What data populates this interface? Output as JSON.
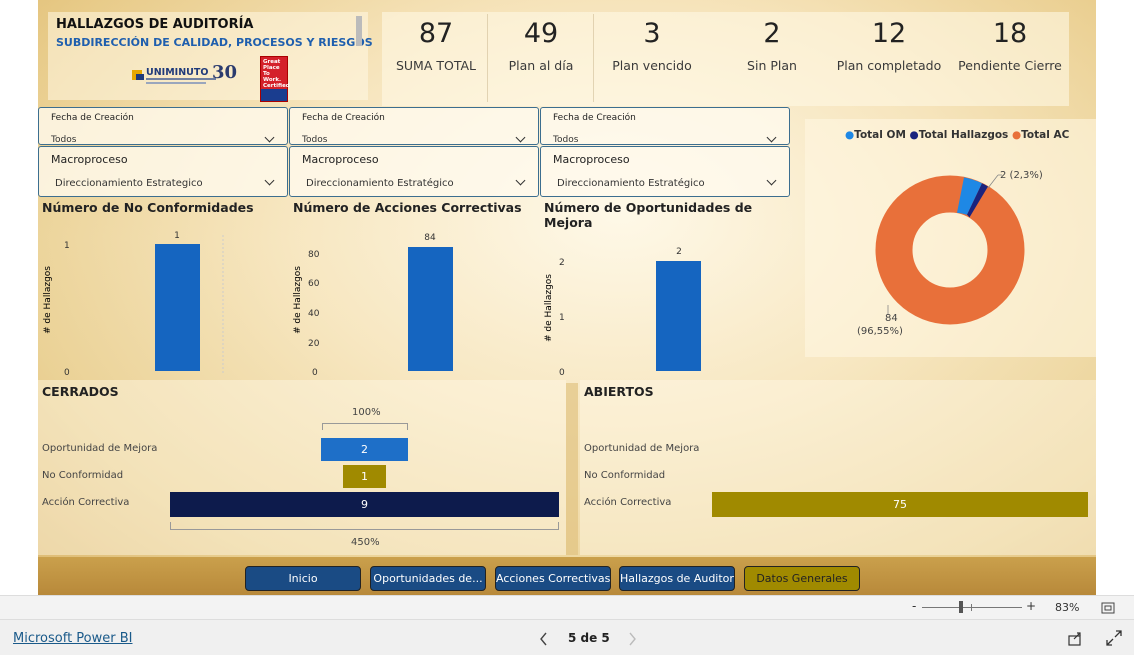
{
  "header": {
    "title": "HALLAZGOS DE AUDITORÍA",
    "subtitle": "SUBDIRECCIÓN DE CALIDAD, PROCESOS Y RIESGOS",
    "logo_text": "UNIMINUTO",
    "badge_lines": [
      "Great",
      "Place",
      "To",
      "Work.",
      "Certified"
    ]
  },
  "kpis": [
    {
      "value": "87",
      "label": "SUMA TOTAL"
    },
    {
      "value": "49",
      "label": "Plan al día"
    },
    {
      "value": "3",
      "label": "Plan vencido"
    },
    {
      "value": "2",
      "label": "Sin Plan"
    },
    {
      "value": "12",
      "label": "Plan completado"
    },
    {
      "value": "18",
      "label": "Pendiente Cierre"
    }
  ],
  "slicers": {
    "fecha_label": "Fecha de Creación",
    "fecha_value": "Todos",
    "macro_label": "Macroproceso",
    "macro_value": "Direccionamiento Estrategico",
    "macro_value_alt": "Direccionamiento Estratégico"
  },
  "charts": {
    "nc": {
      "title": "Número de No Conformidades",
      "ylabel": "# de Hallazgos"
    },
    "ac": {
      "title": "Número de Acciones Correctivas",
      "ylabel": "# de Hallazgos"
    },
    "om": {
      "title_line1": "Número de Oportunidades de",
      "title_line2": "Mejora",
      "ylabel": "# de Hallazgos"
    }
  },
  "chart_data": [
    {
      "type": "bar",
      "title": "Número de No Conformidades",
      "ylabel": "# de Hallazgos",
      "categories": [
        ""
      ],
      "values": [
        1
      ],
      "ylim": [
        0,
        1
      ],
      "yticks": [
        "0",
        "1"
      ],
      "data_labels": [
        "1"
      ]
    },
    {
      "type": "bar",
      "title": "Número de Acciones Correctivas",
      "ylabel": "# de Hallazgos",
      "categories": [
        ""
      ],
      "values": [
        84
      ],
      "ylim": [
        0,
        80
      ],
      "yticks": [
        "0",
        "20",
        "40",
        "60",
        "80"
      ],
      "data_labels": [
        "84"
      ]
    },
    {
      "type": "bar",
      "title": "Número de Oportunidades de Mejora",
      "ylabel": "# de Hallazgos",
      "categories": [
        ""
      ],
      "values": [
        2
      ],
      "ylim": [
        0,
        2
      ],
      "yticks": [
        "0",
        "1",
        "2"
      ],
      "data_labels": [
        "2"
      ]
    },
    {
      "type": "pie",
      "legend": [
        "Total OM",
        "Total Hallazgos",
        "Total AC"
      ],
      "legend_colors": [
        "#1e88e5",
        "#1a237e",
        "#e8703a"
      ],
      "values": [
        2,
        1,
        84
      ],
      "labels": [
        "2 (2,3%)",
        "84",
        "(96,55%)"
      ]
    },
    {
      "type": "bar",
      "title": "CERRADOS",
      "categories": [
        "Oportunidad de Mejora",
        "No Conformidad",
        "Acción Correctiva"
      ],
      "values": [
        2,
        1,
        9
      ],
      "data_labels": [
        "2",
        "1",
        "9"
      ],
      "colors": [
        "#1565c0",
        "#a08a00",
        "#0d1b4c"
      ],
      "top_label": "100%",
      "bottom_label": "450%"
    },
    {
      "type": "bar",
      "title": "ABIERTOS",
      "categories": [
        "Oportunidad de Mejora",
        "No Conformidad",
        "Acción Correctiva"
      ],
      "values": [
        0,
        0,
        75
      ],
      "data_labels": [
        "",
        "",
        "75"
      ],
      "colors": [
        "#a08a00",
        "#a08a00",
        "#a08a00"
      ]
    }
  ],
  "sections": {
    "closed": "CERRADOS",
    "open": "ABIERTOS"
  },
  "nav": [
    "Inicio",
    "Oportunidades de...",
    "Acciones Correctivas",
    "Hallazgos de Auditoría",
    "Datos Generales"
  ],
  "status": {
    "zoom": "83%",
    "minus": "-",
    "plus": "+"
  },
  "footer": {
    "brand": "Microsoft Power BI",
    "page": "5 de 5"
  }
}
